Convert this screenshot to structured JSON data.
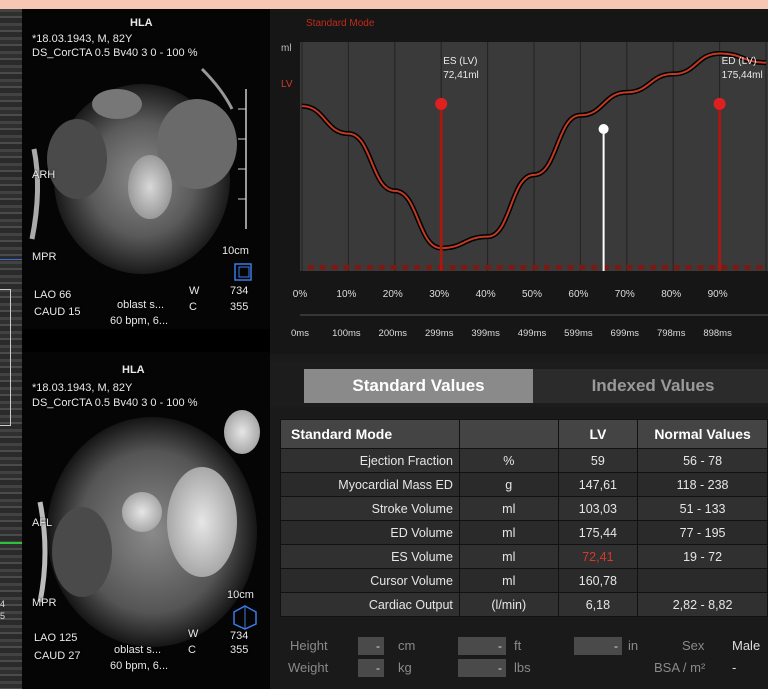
{
  "viewport_top": {
    "plane": "HLA",
    "patient": "*18.03.1943, M, 82Y",
    "series": "DS_CorCTA  0.5  Bv40  3  0 - 100 %",
    "label_side": "ARH",
    "mode": "MPR",
    "scale": "10cm",
    "angle1": "LAO 66",
    "angle2": "CAUD 15",
    "desc1": "oblast s...",
    "desc2": "60 bpm, 6...",
    "w_label": "W",
    "c_label": "C",
    "w_value": "734",
    "c_value": "355"
  },
  "viewport_bottom": {
    "plane": "HLA",
    "patient": "*18.03.1943, M, 82Y",
    "series": "DS_CorCTA  0.5  Bv40  3  0 - 100 %",
    "label_side": "AFL",
    "mode": "MPR",
    "scale": "10cm",
    "angle1": "LAO 125",
    "angle2": "CAUD 27",
    "desc1": "oblast s...",
    "desc2": "60 bpm, 6...",
    "w_label": "W",
    "c_label": "C",
    "w_value": "734",
    "c_value": "355"
  },
  "leftstrip": {
    "num1": "4",
    "num2": "5"
  },
  "chart_data": {
    "type": "line",
    "title": "Standard Mode",
    "ylabel": "ml",
    "series_label": "LV",
    "x_percent": [
      0,
      10,
      20,
      30,
      40,
      50,
      60,
      70,
      80,
      90,
      100
    ],
    "y_relative": [
      0.72,
      0.6,
      0.35,
      0.1,
      0.15,
      0.42,
      0.68,
      0.78,
      0.86,
      0.95,
      0.91
    ],
    "x_ticks_percent": [
      "0%",
      "10%",
      "20%",
      "30%",
      "40%",
      "50%",
      "60%",
      "70%",
      "80%",
      "90%"
    ],
    "x_ticks_ms": [
      "0ms",
      "100ms",
      "200ms",
      "299ms",
      "399ms",
      "499ms",
      "599ms",
      "699ms",
      "798ms",
      "898ms"
    ],
    "markers": [
      {
        "label": "ES (LV)",
        "value": "72,41ml",
        "x_percent": 30,
        "y_relative": 0.97
      },
      {
        "label": "ED (LV)",
        "value": "175,44ml",
        "x_percent": 90,
        "y_relative": 0.97
      }
    ],
    "cursor": {
      "x_percent": 65,
      "y_relative": 0.62
    },
    "grid": true,
    "colors": {
      "curve": "#c43a24",
      "marker": "#e02020",
      "cursor": "#ffffff"
    }
  },
  "tabs": {
    "standard": "Standard Values",
    "indexed": "Indexed Values"
  },
  "table": {
    "headers": [
      "Standard Mode",
      "",
      "LV",
      "Normal Values"
    ],
    "rows": [
      {
        "name": "Ejection Fraction",
        "unit": "%",
        "lv": "59",
        "normal": "56 - 78"
      },
      {
        "name": "Myocardial Mass ED",
        "unit": "g",
        "lv": "147,61",
        "normal": "118 - 238"
      },
      {
        "name": "Stroke Volume",
        "unit": "ml",
        "lv": "103,03",
        "normal": "51 - 133"
      },
      {
        "name": "ED Volume",
        "unit": "ml",
        "lv": "175,44",
        "normal": "77 - 195"
      },
      {
        "name": "ES Volume",
        "unit": "ml",
        "lv": "72,41",
        "normal": "19 - 72"
      },
      {
        "name": "Cursor Volume",
        "unit": "ml",
        "lv": "160,78",
        "normal": ""
      },
      {
        "name": "Cardiac Output",
        "unit": "(l/min)",
        "lv": "6,18",
        "normal": "2,82 - 8,82"
      }
    ]
  },
  "patient_form": {
    "height_label": "Height",
    "weight_label": "Weight",
    "height_value": "-",
    "weight_value": "-",
    "cm_label": "cm",
    "kg_label": "kg",
    "ft_value": "-",
    "lbs_value": "-",
    "ft_label": "ft",
    "lbs_label": "lbs",
    "in_value": "-",
    "in_label": "in",
    "sex_label": "Sex",
    "sex_value": "Male",
    "bsa_label": "BSA / m²",
    "bsa_value": "-"
  }
}
